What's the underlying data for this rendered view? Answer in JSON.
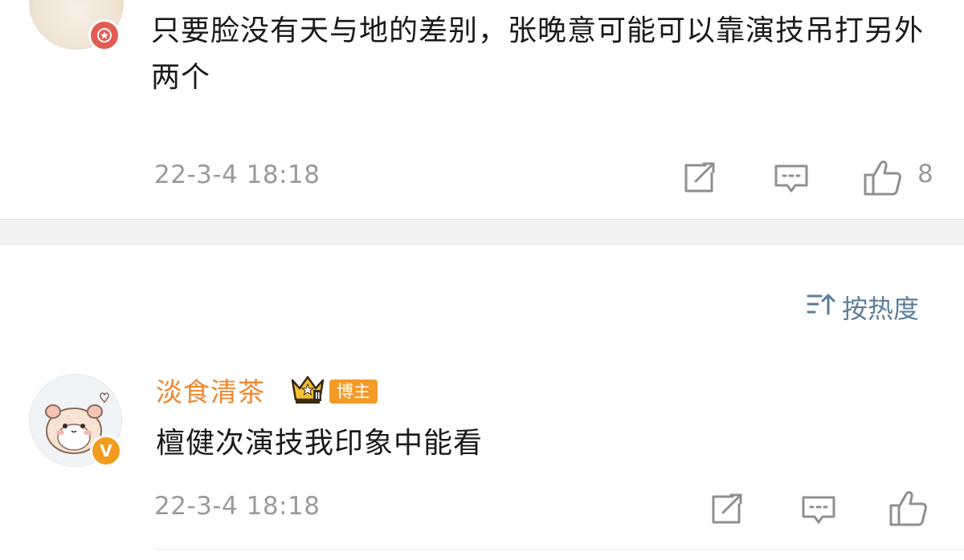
{
  "comments": [
    {
      "text": "只要脸没有天与地的差别，张晚意可能可以靠演技吊打另外两个",
      "time": "22-3-4 18:18",
      "like_count": "8",
      "avatar_icon": "cat-avatar",
      "badge_icon": "red-star-badge-icon"
    },
    {
      "username": "淡食清茶",
      "role_tag": "博主",
      "badge_letter": "V",
      "text": "檀健次演技我印象中能看",
      "time": "22-3-4 18:18",
      "avatar_icon": "hamster-avatar",
      "crown_icon": "crown-level-icon"
    }
  ],
  "sort": {
    "label": "按热度",
    "icon": "sort-icon"
  },
  "colors": {
    "username": "#f0872f",
    "sort": "#5b7e9b",
    "meta": "#9a9a9a",
    "role_tag_bg": "#f39a28",
    "vip_badge": "#f29b1d",
    "red_badge": "#e25c53"
  }
}
